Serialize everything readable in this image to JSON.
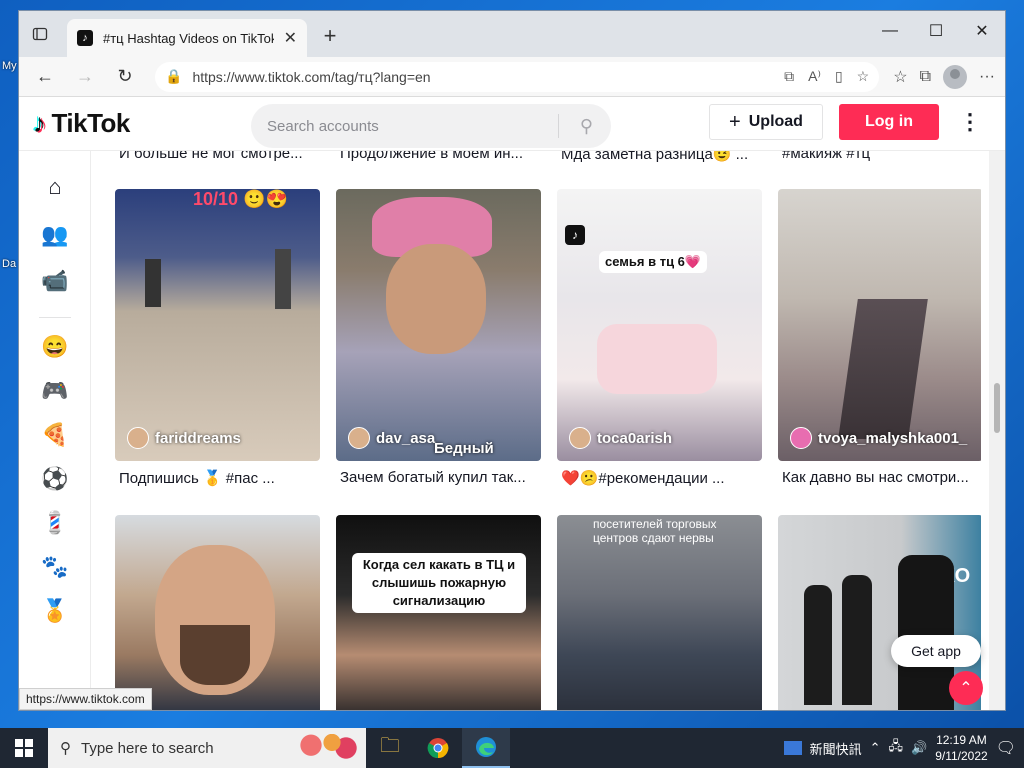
{
  "desktop": {
    "label1": "My",
    "label2": "Da"
  },
  "browser": {
    "tab_title": "#тц Hashtag Videos on TikTok",
    "url": "https://www.tiktok.com/tag/тц?lang=en",
    "status_url": "https://www.tiktok.com"
  },
  "tiktok": {
    "logo_text": "TikTok",
    "search_placeholder": "Search accounts",
    "upload_label": "Upload",
    "login_label": "Log in",
    "prev_captions": [
      "И больше не мог смотре...",
      "Продолжение в моем ин...",
      "Мда заметна разница😉 ...",
      "#макияж #тц"
    ],
    "videos": [
      {
        "user": "fariddreams",
        "caption": "Подпишись 🥇 #пас ...",
        "overlay": "10/10 🙂😍"
      },
      {
        "user": "dav_asa",
        "caption": "Зачем богатый купил так...",
        "overlay": "Бедный"
      },
      {
        "user": "toca0arish",
        "caption": "❤️😕#рекомендации ...",
        "overlay": "семья в тц 6💗"
      },
      {
        "user": "tvoya_malyshka001_",
        "caption": "Как давно вы нас смотри...",
        "overlay": ""
      }
    ],
    "row2": [
      {
        "overlay": ""
      },
      {
        "overlay": "Когда сел какать в ТЦ и слышишь пожарную сигнализацию"
      },
      {
        "overlay": "посетителей торговых центров сдают нервы"
      },
      {
        "overlay": "СКО"
      }
    ],
    "get_app": "Get app"
  },
  "taskbar": {
    "search_placeholder": "Type here to search",
    "news": "新聞快訊",
    "time": "12:19 AM",
    "date": "9/11/2022"
  }
}
